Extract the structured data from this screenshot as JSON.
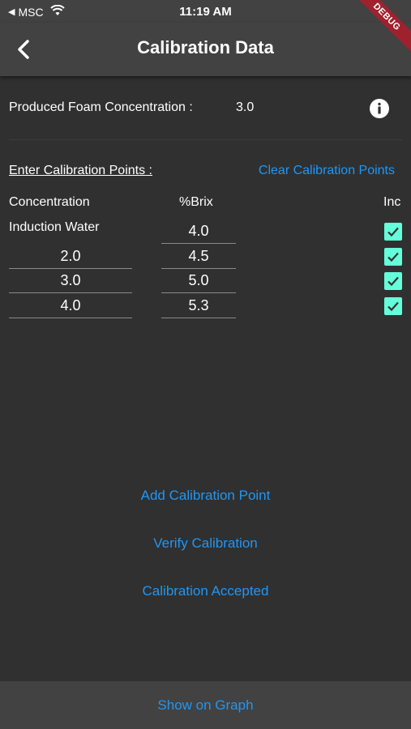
{
  "status_bar": {
    "carrier": "MSC",
    "back_glyph": "◀",
    "time": "11:19 AM"
  },
  "app_bar": {
    "title": "Calibration Data",
    "debug_label": "DEBUG",
    "back_icon": "chevron-left-icon"
  },
  "foam": {
    "label": "Produced Foam Concentration :",
    "value": "3.0",
    "info_icon": "info-icon"
  },
  "calibration": {
    "section_label": "Enter Calibration Points :",
    "clear_label": "Clear Calibration Points",
    "headers": {
      "concentration": "Concentration",
      "brix": "%Brix",
      "inc": "Inc"
    },
    "induction_label": "Induction Water",
    "induction_brix": "4.0",
    "rows": [
      {
        "concentration": "2.0",
        "brix": "4.5",
        "included": true
      },
      {
        "concentration": "3.0",
        "brix": "5.0",
        "included": true
      },
      {
        "concentration": "4.0",
        "brix": "5.3",
        "included": true
      }
    ],
    "induction_included": true
  },
  "actions": {
    "add_point": "Add Calibration Point",
    "verify": "Verify Calibration",
    "accepted": "Calibration Accepted"
  },
  "bottom": {
    "show_graph": "Show on Graph"
  },
  "colors": {
    "accent": "#2196f3",
    "checkbox": "#64ffda",
    "background": "#303030",
    "app_bar": "#424242",
    "debug_banner": "#a0212e"
  }
}
